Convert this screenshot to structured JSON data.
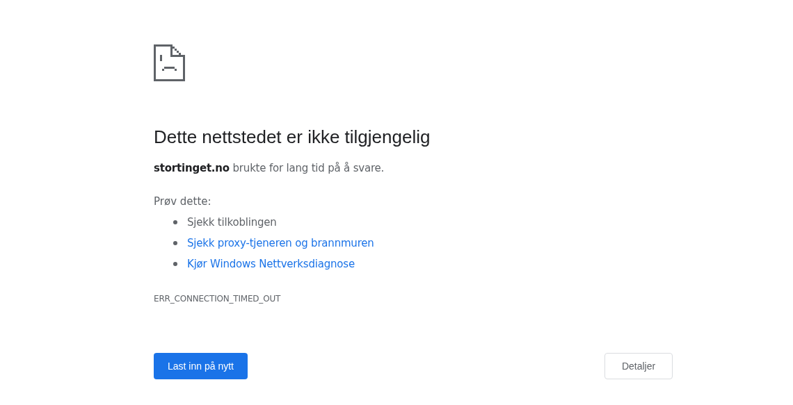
{
  "heading": "Dette nettstedet er ikke tilgjengelig",
  "message": "**stortinget.no** brukte for lang tid på å svare.",
  "suggestions_title": "Prøv dette:",
  "suggestions": [
    {
      "kind": "text",
      "label": "Sjekk tilkoblingen"
    },
    {
      "kind": "link",
      "label": "Sjekk proxy-tjeneren og brannmuren"
    },
    {
      "kind": "link",
      "label": "Kjør Windows Nettverksdiagnose"
    }
  ],
  "error_code": "ERR_CONNECTION_TIMED_OUT",
  "buttons": [
    {
      "kind": "primary",
      "label": "Last inn på nytt"
    },
    {
      "kind": "secondary",
      "label": "Detaljer"
    }
  ]
}
